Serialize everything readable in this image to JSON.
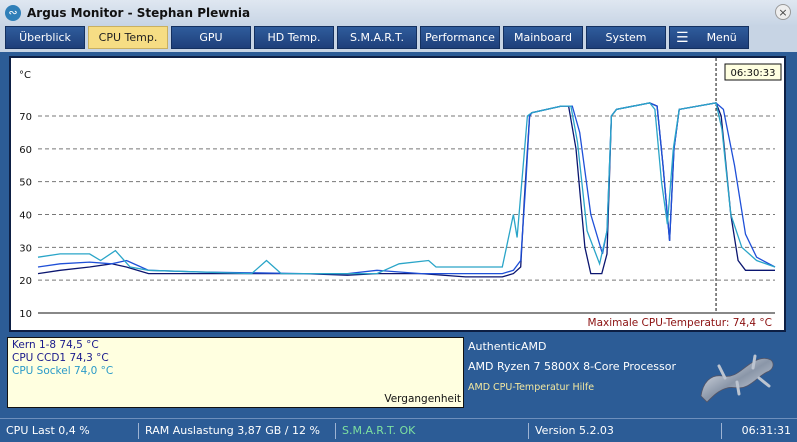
{
  "window": {
    "title": "Argus Monitor - Stephan Plewnia",
    "close": "×"
  },
  "tabs": [
    {
      "label": "Überblick"
    },
    {
      "label": "CPU Temp.",
      "active": true
    },
    {
      "label": "GPU"
    },
    {
      "label": "HD Temp."
    },
    {
      "label": "S.M.A.R.T."
    },
    {
      "label": "Performance"
    },
    {
      "label": "Mainboard"
    },
    {
      "label": "System"
    },
    {
      "label": "Menü"
    }
  ],
  "chart": {
    "unit": "°C",
    "time_label": "06:30:33",
    "cursor_at": 92,
    "max_label": "Maximale CPU-Temperatur: 74,4 °C",
    "y_ticks": [
      10,
      20,
      30,
      40,
      50,
      60,
      70
    ],
    "ylim": [
      10,
      75
    ],
    "xlim": [
      0,
      100
    ],
    "series": [
      {
        "name": "Kern 1-8",
        "color": "#0b1670",
        "points": [
          [
            0,
            22
          ],
          [
            3,
            23
          ],
          [
            7,
            24
          ],
          [
            10,
            25
          ],
          [
            12,
            24
          ],
          [
            15,
            22
          ],
          [
            22,
            22
          ],
          [
            36,
            22
          ],
          [
            42,
            21.5
          ],
          [
            46,
            22
          ],
          [
            52,
            22
          ],
          [
            58,
            21
          ],
          [
            63,
            21
          ],
          [
            64.5,
            22
          ],
          [
            65.5,
            24
          ],
          [
            66,
            45
          ],
          [
            66.7,
            70
          ],
          [
            67,
            71
          ],
          [
            71,
            73
          ],
          [
            72,
            73
          ],
          [
            73,
            60
          ],
          [
            74.2,
            30
          ],
          [
            75,
            22
          ],
          [
            76.5,
            22
          ],
          [
            77.2,
            28
          ],
          [
            77.8,
            70
          ],
          [
            78.5,
            72
          ],
          [
            83,
            74
          ],
          [
            84,
            73
          ],
          [
            84.8,
            55
          ],
          [
            85.7,
            32
          ],
          [
            86.3,
            60
          ],
          [
            87,
            72
          ],
          [
            92,
            74
          ],
          [
            92.7,
            70
          ],
          [
            94,
            40
          ],
          [
            95,
            26
          ],
          [
            96,
            23
          ],
          [
            100,
            23
          ]
        ]
      },
      {
        "name": "CPU CCD1",
        "color": "#1f50d8",
        "points": [
          [
            0,
            24
          ],
          [
            3,
            25
          ],
          [
            7,
            25.5
          ],
          [
            10,
            25
          ],
          [
            12,
            26
          ],
          [
            15,
            23
          ],
          [
            22,
            22.5
          ],
          [
            36,
            22
          ],
          [
            42,
            22
          ],
          [
            46,
            23
          ],
          [
            52,
            22
          ],
          [
            58,
            22
          ],
          [
            63,
            22
          ],
          [
            64.5,
            23
          ],
          [
            65.5,
            26
          ],
          [
            66.2,
            50
          ],
          [
            66.7,
            70
          ],
          [
            67,
            71
          ],
          [
            71,
            73
          ],
          [
            72.5,
            73
          ],
          [
            73.5,
            65
          ],
          [
            75,
            40
          ],
          [
            76.6,
            28
          ],
          [
            77.2,
            35
          ],
          [
            77.8,
            70
          ],
          [
            78.5,
            72
          ],
          [
            83,
            74
          ],
          [
            84,
            73
          ],
          [
            84.8,
            55
          ],
          [
            85.7,
            32
          ],
          [
            86.3,
            60
          ],
          [
            87,
            72
          ],
          [
            92,
            74
          ],
          [
            93,
            72
          ],
          [
            94.5,
            55
          ],
          [
            96,
            34
          ],
          [
            97.5,
            27
          ],
          [
            100,
            24
          ]
        ]
      },
      {
        "name": "CPU Sockel",
        "color": "#2aa5c8",
        "points": [
          [
            0,
            27
          ],
          [
            3,
            28
          ],
          [
            7,
            28
          ],
          [
            8.5,
            26
          ],
          [
            10.5,
            29
          ],
          [
            12.5,
            24
          ],
          [
            15,
            23
          ],
          [
            29,
            22
          ],
          [
            31,
            26
          ],
          [
            33,
            22
          ],
          [
            46,
            22
          ],
          [
            49,
            25
          ],
          [
            53,
            26
          ],
          [
            54,
            24
          ],
          [
            63,
            24
          ],
          [
            64.5,
            40
          ],
          [
            65,
            33
          ],
          [
            66.4,
            70
          ],
          [
            67,
            71
          ],
          [
            71,
            73
          ],
          [
            72.3,
            73
          ],
          [
            73.2,
            62
          ],
          [
            74.5,
            35
          ],
          [
            76.2,
            25
          ],
          [
            77.2,
            35
          ],
          [
            77.8,
            70
          ],
          [
            78.5,
            72
          ],
          [
            83,
            74
          ],
          [
            83.7,
            72
          ],
          [
            84.6,
            50
          ],
          [
            85.4,
            37
          ],
          [
            86.2,
            60
          ],
          [
            87,
            72
          ],
          [
            92,
            74
          ],
          [
            92.8,
            66
          ],
          [
            94,
            40
          ],
          [
            95.5,
            30
          ],
          [
            97.5,
            26
          ],
          [
            100,
            24
          ]
        ]
      }
    ]
  },
  "temps": [
    {
      "label": "Kern 1-8 74,5 °C",
      "color": "#1a1a8c"
    },
    {
      "label": "CPU CCD1 74,3 °C",
      "color": "#1a1a8c"
    },
    {
      "label": "CPU Sockel 74,0 °C",
      "color": "#2a9ac8"
    }
  ],
  "history_label": "Vergangenheit",
  "cpu_info": {
    "vendor": "AuthenticAMD",
    "model": "AMD Ryzen 7 5800X 8-Core Processor",
    "help": "AMD CPU-Temperatur Hilfe"
  },
  "status": {
    "cpu": "CPU Last 0,4 %",
    "ram": "RAM Auslastung 3,87 GB / 12 %",
    "smart": "S.M.A.R.T. OK",
    "version": "Version 5.2.03",
    "time": "06:31:31"
  },
  "colors": {
    "smart_ok": "#7de0a0",
    "max_label": "#8b1010"
  }
}
